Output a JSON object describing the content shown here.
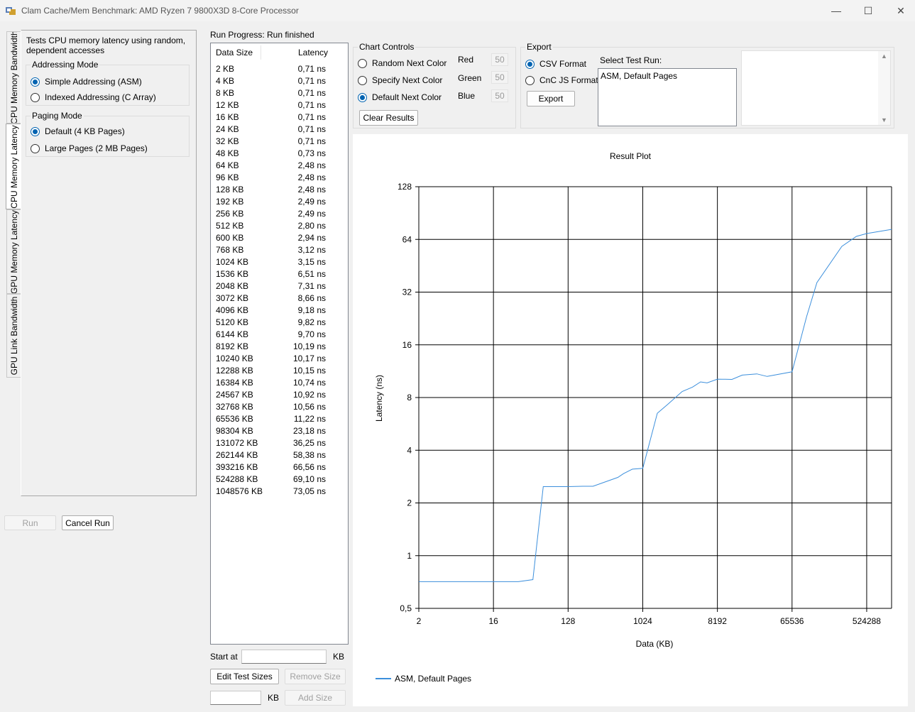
{
  "window": {
    "title": "Clam Cache/Mem Benchmark: AMD Ryzen 7 9800X3D 8-Core Processor",
    "minimize": "—",
    "maximize": "☐",
    "close": "✕"
  },
  "tabs": [
    {
      "label": "CPU Memory Bandwidth"
    },
    {
      "label": "CPU Memory Latency"
    },
    {
      "label": "GPU Memory Latency"
    },
    {
      "label": "GPU Link Bandwidth"
    }
  ],
  "latency_tab": {
    "description": "Tests CPU memory latency using random, dependent accesses",
    "addressing_mode": {
      "title": "Addressing Mode",
      "options": [
        {
          "label": "Simple Addressing (ASM)",
          "checked": true
        },
        {
          "label": "Indexed Addressing (C Array)",
          "checked": false
        }
      ]
    },
    "paging_mode": {
      "title": "Paging Mode",
      "options": [
        {
          "label": "Default (4 KB Pages)",
          "checked": true
        },
        {
          "label": "Large Pages (2 MB Pages)",
          "checked": false
        }
      ]
    }
  },
  "run_button": "Run",
  "cancel_button": "Cancel Run",
  "progress": {
    "label": "Run Progress:",
    "value": "Run finished"
  },
  "results_list": {
    "columns": [
      "Data Size",
      "Latency"
    ],
    "rows": [
      [
        "2 KB",
        "0,71 ns"
      ],
      [
        "4 KB",
        "0,71 ns"
      ],
      [
        "8 KB",
        "0,71 ns"
      ],
      [
        "12 KB",
        "0,71 ns"
      ],
      [
        "16 KB",
        "0,71 ns"
      ],
      [
        "24 KB",
        "0,71 ns"
      ],
      [
        "32 KB",
        "0,71 ns"
      ],
      [
        "48 KB",
        "0,73 ns"
      ],
      [
        "64 KB",
        "2,48 ns"
      ],
      [
        "96 KB",
        "2,48 ns"
      ],
      [
        "128 KB",
        "2,48 ns"
      ],
      [
        "192 KB",
        "2,49 ns"
      ],
      [
        "256 KB",
        "2,49 ns"
      ],
      [
        "512 KB",
        "2,80 ns"
      ],
      [
        "600 KB",
        "2,94 ns"
      ],
      [
        "768 KB",
        "3,12 ns"
      ],
      [
        "1024 KB",
        "3,15 ns"
      ],
      [
        "1536 KB",
        "6,51 ns"
      ],
      [
        "2048 KB",
        "7,31 ns"
      ],
      [
        "3072 KB",
        "8,66 ns"
      ],
      [
        "4096 KB",
        "9,18 ns"
      ],
      [
        "5120 KB",
        "9,82 ns"
      ],
      [
        "6144 KB",
        "9,70 ns"
      ],
      [
        "8192 KB",
        "10,19 ns"
      ],
      [
        "10240 KB",
        "10,17 ns"
      ],
      [
        "12288 KB",
        "10,15 ns"
      ],
      [
        "16384 KB",
        "10,74 ns"
      ],
      [
        "24567 KB",
        "10,92 ns"
      ],
      [
        "32768 KB",
        "10,56 ns"
      ],
      [
        "65536 KB",
        "11,22 ns"
      ],
      [
        "98304 KB",
        "23,18 ns"
      ],
      [
        "131072 KB",
        "36,25 ns"
      ],
      [
        "262144 KB",
        "58,38 ns"
      ],
      [
        "393216 KB",
        "66,56 ns"
      ],
      [
        "524288 KB",
        "69,10 ns"
      ],
      [
        "1048576 KB",
        "73,05 ns"
      ]
    ]
  },
  "start_at": {
    "label": "Start at",
    "value": "",
    "unit": "KB"
  },
  "edit_sizes_button": "Edit Test Sizes",
  "remove_size_button": "Remove Size",
  "add_size": {
    "value": "",
    "unit": "KB",
    "button": "Add Size"
  },
  "chart_controls": {
    "title": "Chart Controls",
    "options": [
      {
        "label": "Random Next Color",
        "checked": false
      },
      {
        "label": "Specify Next Color",
        "checked": false
      },
      {
        "label": "Default Next Color",
        "checked": true
      }
    ],
    "red_label": "Red",
    "red_value": "50",
    "green_label": "Green",
    "green_value": "50",
    "blue_label": "Blue",
    "blue_value": "50",
    "clear_button": "Clear Results"
  },
  "export": {
    "title": "Export",
    "options": [
      {
        "label": "CSV Format",
        "checked": true
      },
      {
        "label": "CnC JS Format",
        "checked": false
      }
    ],
    "button": "Export",
    "select_label": "Select Test Run:",
    "runs": [
      "ASM, Default Pages"
    ]
  },
  "scroll_up": "▲",
  "scroll_down": "▼",
  "colors": {
    "series": "#3c8fdc",
    "accent": "#0063b1"
  },
  "chart_data": {
    "type": "line",
    "title": "Result Plot",
    "xlabel": "Data (KB)",
    "ylabel": "Latency (ns)",
    "x_scale": "log2",
    "y_scale": "log2",
    "xlim": [
      2,
      1048576
    ],
    "ylim": [
      0.5,
      128
    ],
    "x_ticks": [
      2,
      16,
      128,
      1024,
      8192,
      65536,
      524288
    ],
    "x_tick_labels": [
      "2",
      "16",
      "128",
      "1024",
      "8192",
      "65536",
      "524288"
    ],
    "y_ticks": [
      0.5,
      1,
      2,
      4,
      8,
      16,
      32,
      64,
      128
    ],
    "y_tick_labels": [
      "0,5",
      "1",
      "2",
      "4",
      "8",
      "16",
      "32",
      "64",
      "128"
    ],
    "grid": true,
    "legend": "bottom-left",
    "series": [
      {
        "name": "ASM, Default Pages",
        "x": [
          2,
          4,
          8,
          12,
          16,
          24,
          32,
          48,
          64,
          96,
          128,
          192,
          256,
          512,
          600,
          768,
          1024,
          1536,
          2048,
          3072,
          4096,
          5120,
          6144,
          8192,
          10240,
          12288,
          16384,
          24567,
          32768,
          65536,
          98304,
          131072,
          262144,
          393216,
          524288,
          1048576
        ],
        "y": [
          0.71,
          0.71,
          0.71,
          0.71,
          0.71,
          0.71,
          0.71,
          0.73,
          2.48,
          2.48,
          2.48,
          2.49,
          2.49,
          2.8,
          2.94,
          3.12,
          3.15,
          6.51,
          7.31,
          8.66,
          9.18,
          9.82,
          9.7,
          10.19,
          10.17,
          10.15,
          10.74,
          10.92,
          10.56,
          11.22,
          23.18,
          36.25,
          58.38,
          66.56,
          69.1,
          73.05
        ]
      }
    ]
  }
}
